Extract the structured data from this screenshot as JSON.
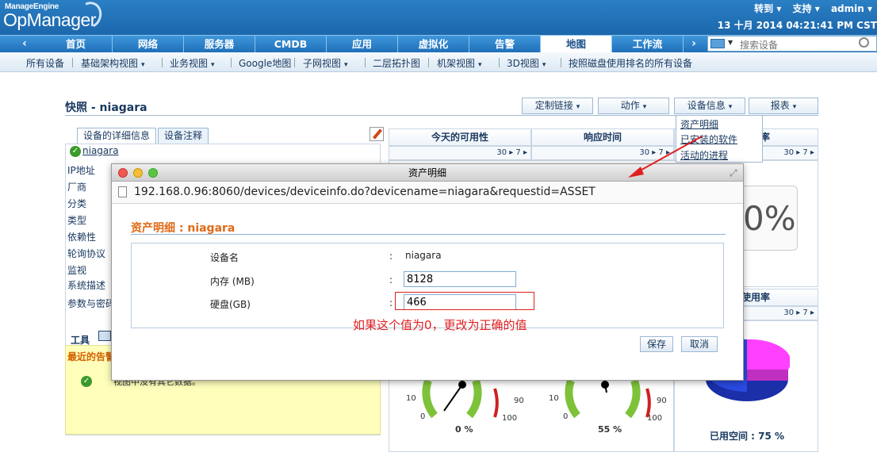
{
  "header": {
    "brand_top": "ManageEngine",
    "brand_main": "OpManager",
    "links": [
      "转到 ▾",
      "支持 ▾",
      "admin ▾"
    ],
    "datetime": "13 十月 2014 04:21:41 PM CST"
  },
  "nav": {
    "items": [
      "首页",
      "网络",
      "服务器",
      "CMDB",
      "应用",
      "虚拟化",
      "告警",
      "地图",
      "工作流"
    ],
    "active": "地图",
    "search_placeholder": "搜索设备"
  },
  "subnav": {
    "items": [
      "所有设备",
      "基础架构视图",
      "业务视图",
      "Google地图",
      "子网视图",
      "二层拓扑图",
      "机架视图",
      "3D视图",
      "按照磁盘使用排名的所有设备"
    ]
  },
  "snapshot": {
    "title": "快照 - niagara",
    "buttons": [
      "定制链接",
      "动作",
      "设备信息",
      "报表"
    ],
    "dropdown_items": [
      "资产明细",
      "已安装的软件",
      "活动的进程"
    ]
  },
  "left_panel": {
    "tabs": [
      "设备的详细信息",
      "设备注释"
    ],
    "device_name": "niagara",
    "rows": [
      "IP地址",
      "厂商",
      "分类",
      "类型",
      "依赖性",
      "轮询协议",
      "监视",
      "系统描述",
      "参数与密码"
    ],
    "tools_label": "工具",
    "alarm_label": "最近的告警",
    "alarm_text": "视图中没有其它数据。"
  },
  "right_panels": {
    "col1": "今天的可用性",
    "col2": "响应时间",
    "col3": "率",
    "disk_title": "使用率",
    "big_percent": "0%",
    "gauge1_value": "0 %",
    "gauge2_value": "55 %",
    "used_space_label": "已用空间 :",
    "used_space_value": "75 %",
    "pager": "30 ▸ 7 ▸",
    "gauge_ticks": [
      "10",
      "0",
      "90",
      "100"
    ]
  },
  "dialog": {
    "title": "资产明细",
    "url": "192.168.0.96:8060/devices/deviceinfo.do?devicename=niagara&requestid=ASSET",
    "heading": "资产明细 : niagara",
    "fields": [
      {
        "label": "设备名",
        "value": "niagara"
      },
      {
        "label": "内存 (MB)",
        "value": "8128"
      },
      {
        "label": "硬盘(GB)",
        "value": "466"
      }
    ],
    "note": "如果这个值为0，更改为正确的值",
    "save": "保存",
    "cancel": "取消"
  }
}
